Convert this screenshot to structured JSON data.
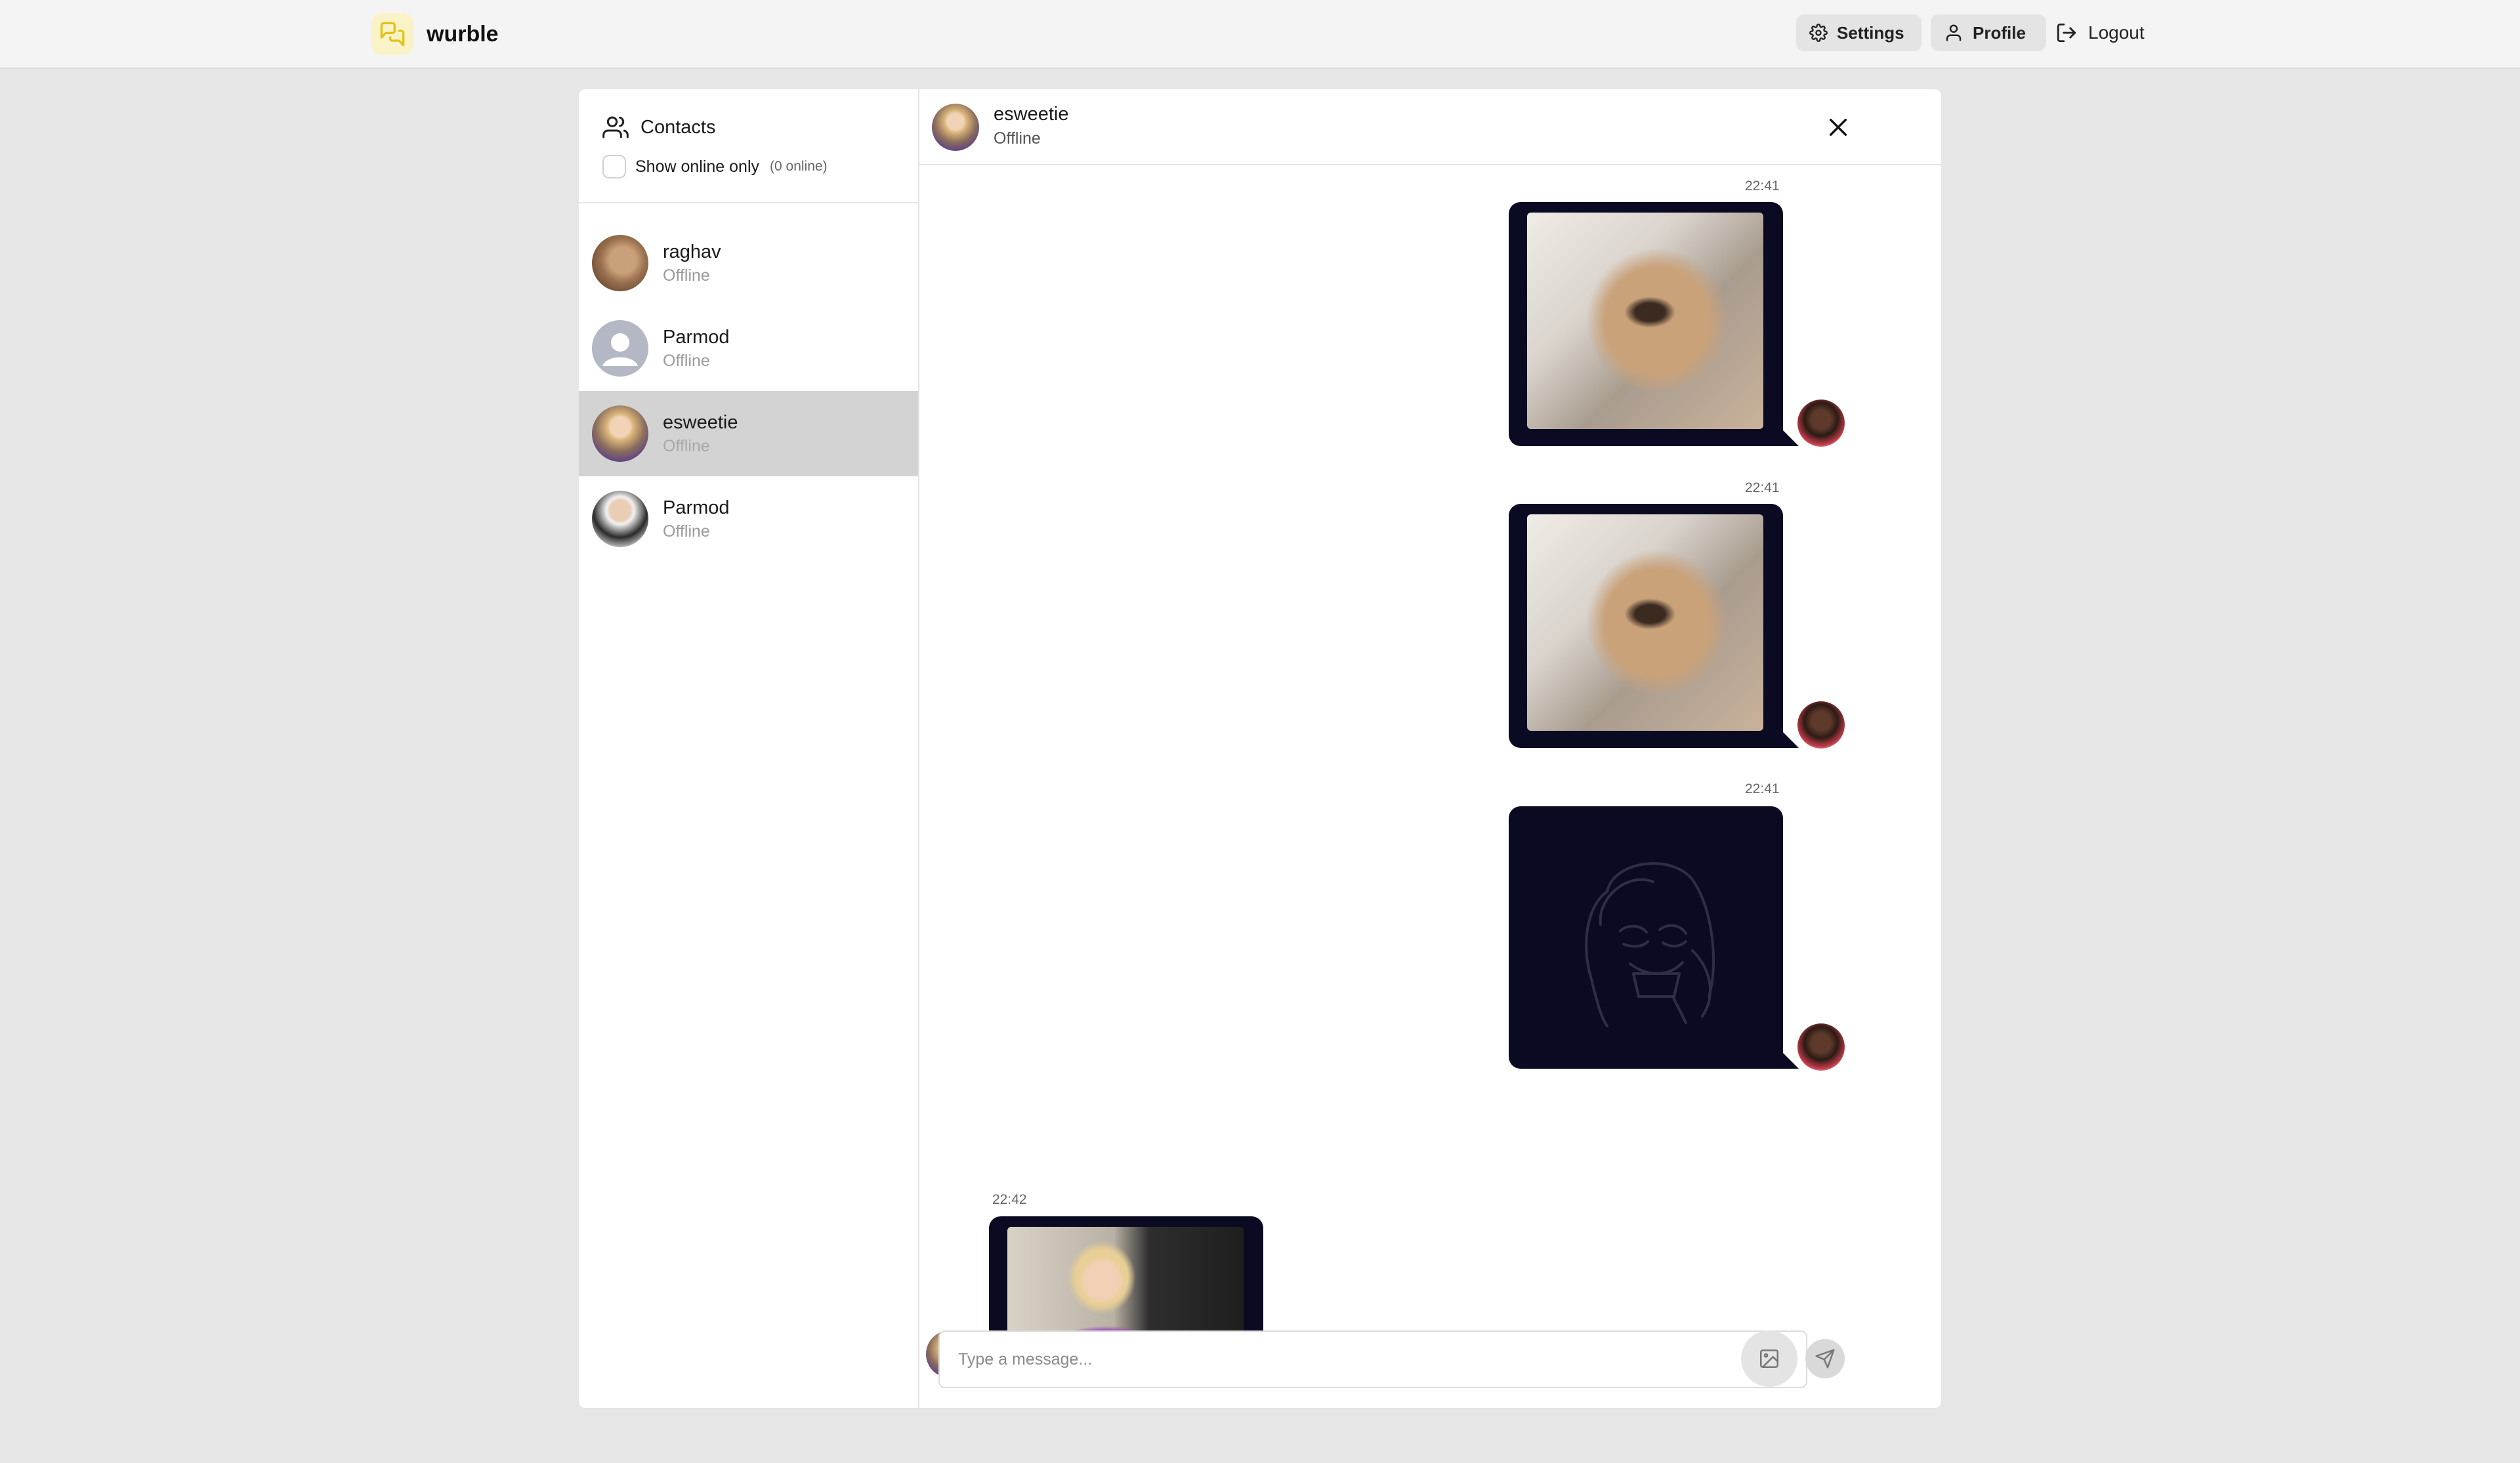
{
  "app": {
    "name": "wurble"
  },
  "nav": {
    "settings": "Settings",
    "profile": "Profile",
    "logout": "Logout"
  },
  "sidebar": {
    "title": "Contacts",
    "online_filter_label": "Show online only",
    "online_count": "(0 online)",
    "contacts": [
      {
        "name": "raghav",
        "status": "Offline"
      },
      {
        "name": "Parmod",
        "status": "Offline"
      },
      {
        "name": "esweetie",
        "status": "Offline",
        "selected": true
      },
      {
        "name": "Parmod",
        "status": "Offline"
      }
    ]
  },
  "chat": {
    "contact_name": "esweetie",
    "contact_status": "Offline",
    "messages": [
      {
        "time": "22:41",
        "direction": "outgoing",
        "content": "image"
      },
      {
        "time": "22:41",
        "direction": "outgoing",
        "content": "image"
      },
      {
        "time": "22:41",
        "direction": "outgoing",
        "content": "image"
      },
      {
        "time": "22:42",
        "direction": "incoming",
        "content": "image"
      }
    ],
    "composer_placeholder": "Type a message..."
  },
  "colors": {
    "bubble": "#0a0a22",
    "selected_contact": "#d3d3d3",
    "background": "#e6e6e6",
    "brand_icon_bg": "#faf3c7",
    "brand_icon": "#e3c21a"
  }
}
